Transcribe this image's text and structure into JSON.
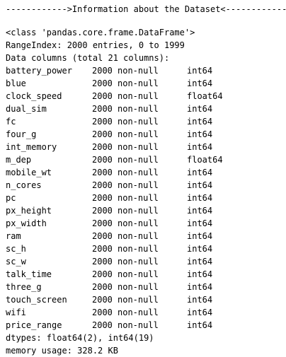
{
  "header": "------------>Information about the Dataset<------------",
  "class_line": "<class 'pandas.core.frame.DataFrame'>",
  "range_index": "RangeIndex: 2000 entries, 0 to 1999",
  "columns_header": "Data columns (total 21 columns):",
  "columns": [
    {
      "name": "battery_power",
      "count": "2000",
      "nonnull": "non-null",
      "dtype": "int64"
    },
    {
      "name": "blue",
      "count": "2000",
      "nonnull": "non-null",
      "dtype": "int64"
    },
    {
      "name": "clock_speed",
      "count": "2000",
      "nonnull": "non-null",
      "dtype": "float64"
    },
    {
      "name": "dual_sim",
      "count": "2000",
      "nonnull": "non-null",
      "dtype": "int64"
    },
    {
      "name": "fc",
      "count": "2000",
      "nonnull": "non-null",
      "dtype": "int64"
    },
    {
      "name": "four_g",
      "count": "2000",
      "nonnull": "non-null",
      "dtype": "int64"
    },
    {
      "name": "int_memory",
      "count": "2000",
      "nonnull": "non-null",
      "dtype": "int64"
    },
    {
      "name": "m_dep",
      "count": "2000",
      "nonnull": "non-null",
      "dtype": "float64"
    },
    {
      "name": "mobile_wt",
      "count": "2000",
      "nonnull": "non-null",
      "dtype": "int64"
    },
    {
      "name": "n_cores",
      "count": "2000",
      "nonnull": "non-null",
      "dtype": "int64"
    },
    {
      "name": "pc",
      "count": "2000",
      "nonnull": "non-null",
      "dtype": "int64"
    },
    {
      "name": "px_height",
      "count": "2000",
      "nonnull": "non-null",
      "dtype": "int64"
    },
    {
      "name": "px_width",
      "count": "2000",
      "nonnull": "non-null",
      "dtype": "int64"
    },
    {
      "name": "ram",
      "count": "2000",
      "nonnull": "non-null",
      "dtype": "int64"
    },
    {
      "name": "sc_h",
      "count": "2000",
      "nonnull": "non-null",
      "dtype": "int64"
    },
    {
      "name": "sc_w",
      "count": "2000",
      "nonnull": "non-null",
      "dtype": "int64"
    },
    {
      "name": "talk_time",
      "count": "2000",
      "nonnull": "non-null",
      "dtype": "int64"
    },
    {
      "name": "three_g",
      "count": "2000",
      "nonnull": "non-null",
      "dtype": "int64"
    },
    {
      "name": "touch_screen",
      "count": "2000",
      "nonnull": "non-null",
      "dtype": "int64"
    },
    {
      "name": "wifi",
      "count": "2000",
      "nonnull": "non-null",
      "dtype": "int64"
    },
    {
      "name": "price_range",
      "count": "2000",
      "nonnull": "non-null",
      "dtype": "int64"
    }
  ],
  "dtypes_line": "dtypes: float64(2), int64(19)",
  "memory_line": "memory usage: 328.2 KB"
}
